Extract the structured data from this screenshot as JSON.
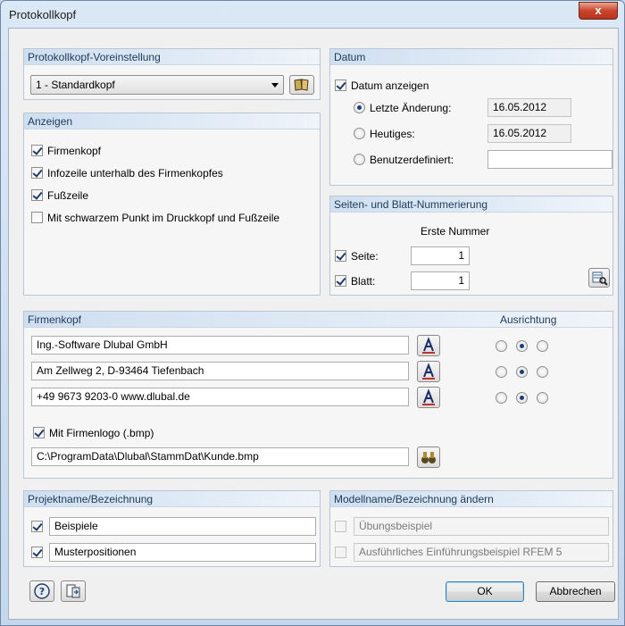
{
  "window": {
    "title": "Protokollkopf",
    "close_glyph": "x"
  },
  "preset": {
    "heading": "Protokollkopf-Voreinstellung",
    "selected": "1 - Standardkopf"
  },
  "show": {
    "heading": "Anzeigen",
    "items": [
      {
        "label": "Firmenkopf",
        "checked": true
      },
      {
        "label": "Infozeile unterhalb des Firmenkopfes",
        "checked": true
      },
      {
        "label": "Fußzeile",
        "checked": true
      },
      {
        "label": "Mit schwarzem Punkt im Druckkopf und Fußzeile",
        "checked": false
      }
    ]
  },
  "date": {
    "heading": "Datum",
    "show_label": "Datum anzeigen",
    "show_checked": true,
    "options": [
      {
        "label": "Letzte Änderung:",
        "value": "16.05.2012",
        "selected": true
      },
      {
        "label": "Heutiges:",
        "value": "16.05.2012",
        "selected": false
      },
      {
        "label": "Benutzerdefiniert:",
        "value": "",
        "selected": false
      }
    ]
  },
  "numbering": {
    "heading": "Seiten- und Blatt-Nummerierung",
    "column_label": "Erste Nummer",
    "page_label": "Seite:",
    "page_value": "1",
    "sheet_label": "Blatt:",
    "sheet_value": "1"
  },
  "company": {
    "heading": "Firmenkopf",
    "alignment_heading": "Ausrichtung",
    "lines": [
      {
        "text": "Ing.-Software Dlubal GmbH",
        "align": "center"
      },
      {
        "text": "Am Zellweg 2, D-93464 Tiefenbach",
        "align": "center"
      },
      {
        "text": "+49 9673 9203-0   www.dlubal.de",
        "align": "center"
      }
    ],
    "logo_label": "Mit Firmenlogo (.bmp)",
    "logo_checked": true,
    "logo_path": "C:\\ProgramData\\Dlubal\\StammDat\\Kunde.bmp"
  },
  "project": {
    "heading": "Projektname/Bezeichnung",
    "items": [
      {
        "value": "Beispiele",
        "checked": true
      },
      {
        "value": "Musterpositionen",
        "checked": true
      }
    ]
  },
  "model": {
    "heading": "Modellname/Bezeichnung ändern",
    "items": [
      {
        "value": "Übungsbeispiel",
        "checked": false
      },
      {
        "value": "Ausführliches Einführungsbeispiel RFEM 5",
        "checked": false
      }
    ]
  },
  "footer": {
    "ok_label": "OK",
    "cancel_label": "Abbrechen"
  }
}
